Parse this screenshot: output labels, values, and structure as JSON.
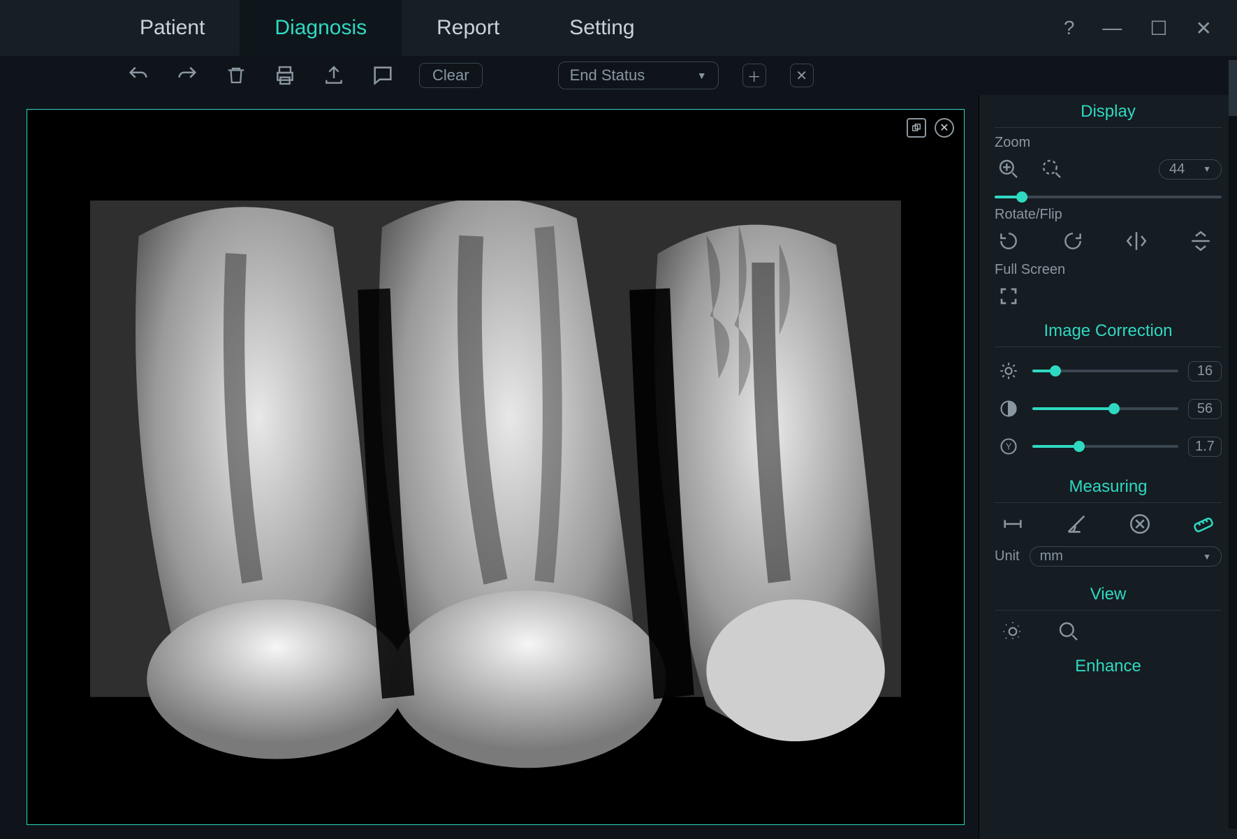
{
  "tabs": {
    "patient": "Patient",
    "diagnosis": "Diagnosis",
    "report": "Report",
    "setting": "Setting"
  },
  "window": {
    "help": "?",
    "min": "—",
    "max": "☐",
    "close": "✕"
  },
  "toolbar": {
    "clear": "Clear",
    "status": "End Status"
  },
  "sidebar": {
    "display": {
      "title": "Display",
      "zoom_label": "Zoom",
      "zoom_value": "44",
      "rotate_label": "Rotate/Flip",
      "fullscreen_label": "Full Screen"
    },
    "correction": {
      "title": "Image Correction",
      "brightness": "16",
      "contrast": "56",
      "gamma": "1.7"
    },
    "measuring": {
      "title": "Measuring",
      "unit_label": "Unit",
      "unit_value": "mm"
    },
    "view": {
      "title": "View"
    },
    "enhance": {
      "title": "Enhance"
    }
  },
  "sliders": {
    "zoom_pct": 12,
    "brightness_pct": 16,
    "contrast_pct": 56,
    "gamma_pct": 32
  }
}
